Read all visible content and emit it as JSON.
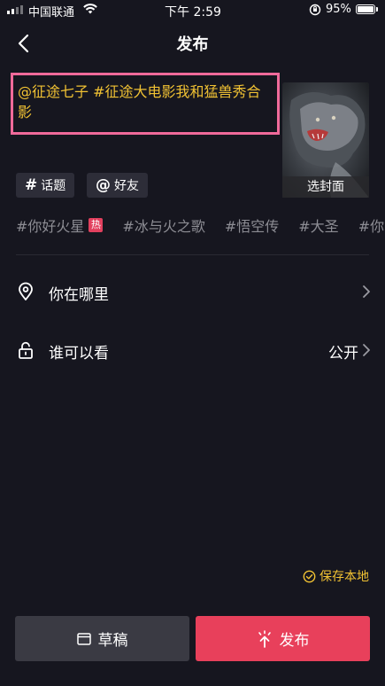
{
  "status_bar": {
    "carrier": "中国联通",
    "time": "下午 2:59",
    "battery": "95%"
  },
  "nav": {
    "title": "发布"
  },
  "caption": {
    "text": "@征途七子 #征途大电影我和猛兽秀合影"
  },
  "cover": {
    "label": "选封面"
  },
  "chips": {
    "topic": {
      "symbol": "#",
      "label": "话题"
    },
    "friend": {
      "symbol": "@",
      "label": "好友"
    }
  },
  "topics": [
    {
      "label": "#你好火星",
      "badge": "热"
    },
    {
      "label": "#冰与火之歌"
    },
    {
      "label": "#悟空传"
    },
    {
      "label": "#大圣"
    },
    {
      "label": "#你"
    }
  ],
  "rows": {
    "location": {
      "label": "你在哪里"
    },
    "privacy": {
      "label": "谁可以看",
      "value": "公开"
    }
  },
  "save_local": {
    "label": "保存本地"
  },
  "buttons": {
    "draft": "草稿",
    "publish": "发布"
  },
  "colors": {
    "background": "#16161f",
    "caption_text": "#f1c233",
    "highlight_border": "#f06a9a",
    "publish_button": "#e8405b",
    "draft_button": "#3a3a43",
    "hot_badge": "#e2405e"
  }
}
